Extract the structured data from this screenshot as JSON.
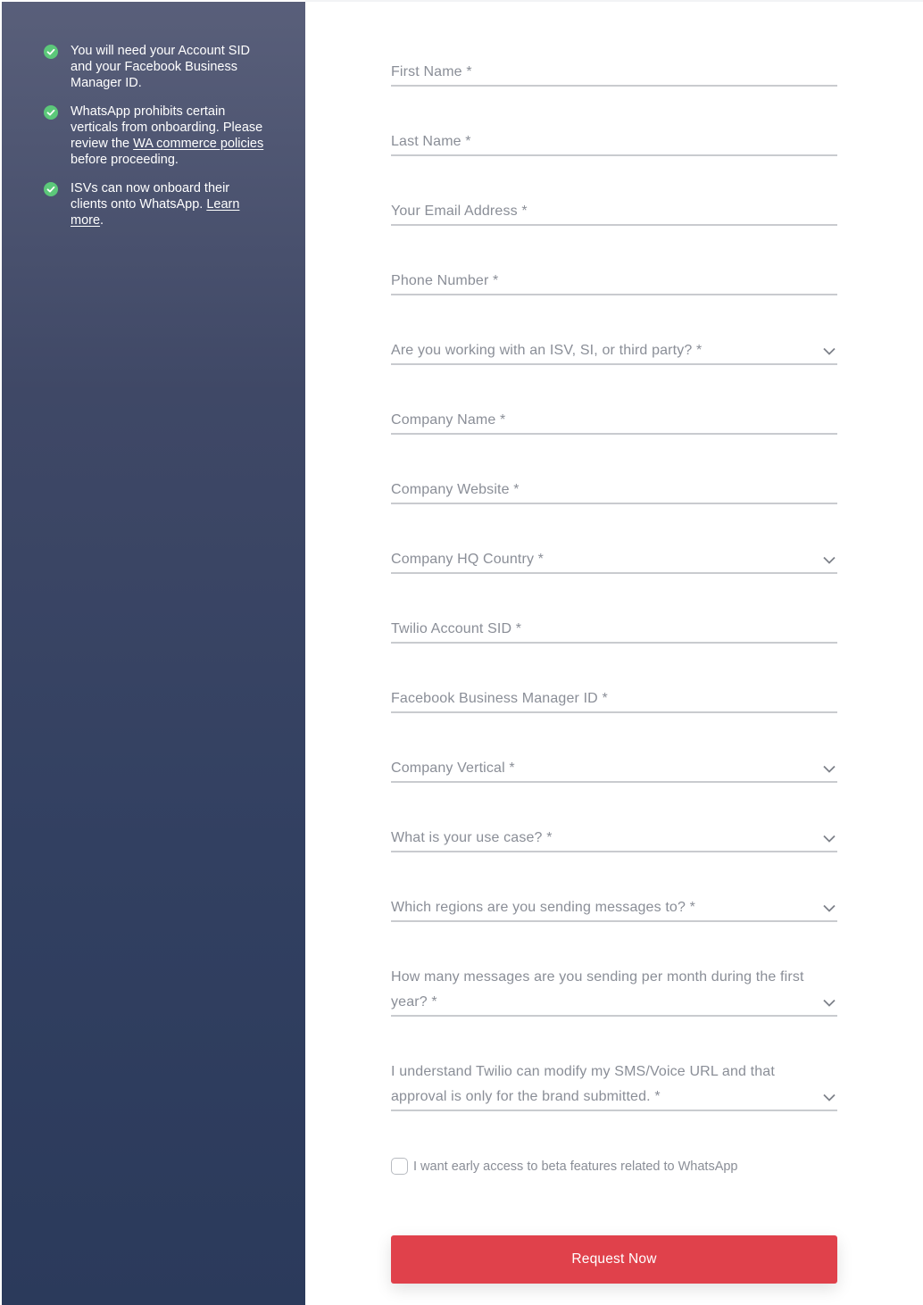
{
  "sidebar": {
    "bullets": [
      {
        "text": "You will need your Account SID and your Facebook Business Manager ID."
      },
      {
        "pre": "WhatsApp prohibits certain verticals from onboarding. Please review the ",
        "link": "WA commerce policies",
        "post": " before proceeding."
      },
      {
        "pre": "ISVs can now onboard their clients onto WhatsApp. ",
        "link": "Learn more",
        "post": "."
      }
    ]
  },
  "form": {
    "fields": [
      {
        "label": "First Name *"
      },
      {
        "label": "Last Name *"
      },
      {
        "label": "Your Email Address *"
      },
      {
        "label": "Phone Number *"
      },
      {
        "label": "Are you working with an ISV, SI, or third party? *"
      },
      {
        "label": "Company Name *"
      },
      {
        "label": "Company Website *"
      },
      {
        "label": "Company HQ Country *"
      },
      {
        "label": "Twilio Account SID *"
      },
      {
        "label": "Facebook Business Manager ID *"
      },
      {
        "label": "Company Vertical *"
      },
      {
        "label": "What is your use case? *"
      },
      {
        "label": "Which regions are you sending messages to? *"
      },
      {
        "label": "How many messages are you sending per month during the first year? *"
      },
      {
        "label": "I understand Twilio can modify my SMS/Voice URL and that approval is only for the brand submitted. *"
      }
    ],
    "checkbox_label": "I want early access to beta features related to WhatsApp",
    "submit_label": "Request Now"
  },
  "colors": {
    "accent": "#e0414b",
    "check": "#5cc87a",
    "sidebar_top": "#595f7a",
    "sidebar_bottom": "#2b3a5b"
  }
}
